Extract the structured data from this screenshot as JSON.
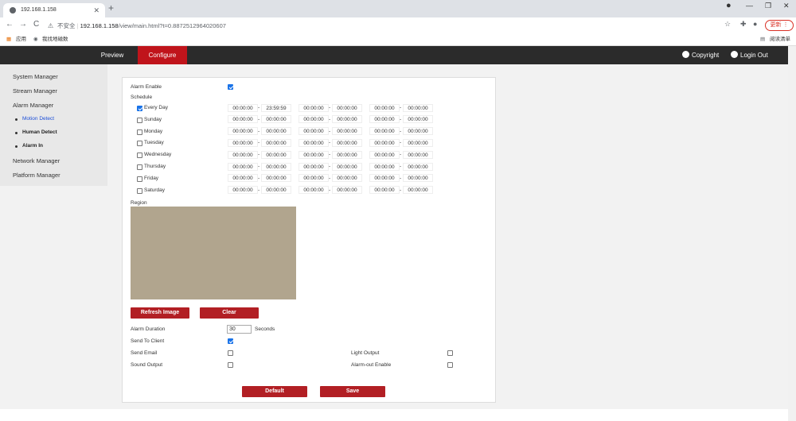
{
  "browser": {
    "tab_title": "192.168.1.158",
    "new_tab": "+",
    "back": "←",
    "forward": "→",
    "reload": "C",
    "security": "不安全",
    "url_host": "192.168.1.158",
    "url_path": "/view/main.html?t=0.8872512964020607",
    "update_label": "更新",
    "bookmarks": [
      "应用",
      "我找地磁数"
    ],
    "reading_list": "阅读清单"
  },
  "topbar": {
    "menus": [
      "Preview",
      "Configure"
    ],
    "active": "Configure",
    "copyright": "Copyright",
    "logout": "Login Out"
  },
  "sidebar": {
    "items": [
      "System Manager",
      "Stream Manager",
      "Alarm Manager",
      "Network Manager",
      "Platform Manager"
    ],
    "subitems": [
      "Motion Detect",
      "Human Detect",
      "Alarm In"
    ],
    "active_sub": "Motion Detect"
  },
  "form": {
    "alarm_enable": "Alarm Enable",
    "alarm_enable_checked": true,
    "schedule": "Schedule",
    "days": [
      {
        "label": "Every Day",
        "checked": true,
        "times": [
          "00:00:00",
          "23:59:59",
          "00:00:00",
          "00:00:00",
          "00:00:00",
          "00:00:00"
        ]
      },
      {
        "label": "Sunday",
        "checked": false,
        "times": [
          "00:00:00",
          "00:00:00",
          "00:00:00",
          "00:00:00",
          "00:00:00",
          "00:00:00"
        ]
      },
      {
        "label": "Monday",
        "checked": false,
        "times": [
          "00:00:00",
          "00:00:00",
          "00:00:00",
          "00:00:00",
          "00:00:00",
          "00:00:00"
        ]
      },
      {
        "label": "Tuesday",
        "checked": false,
        "times": [
          "00:00:00",
          "00:00:00",
          "00:00:00",
          "00:00:00",
          "00:00:00",
          "00:00:00"
        ]
      },
      {
        "label": "Wednesday",
        "checked": false,
        "times": [
          "00:00:00",
          "00:00:00",
          "00:00:00",
          "00:00:00",
          "00:00:00",
          "00:00:00"
        ]
      },
      {
        "label": "Thursday",
        "checked": false,
        "times": [
          "00:00:00",
          "00:00:00",
          "00:00:00",
          "00:00:00",
          "00:00:00",
          "00:00:00"
        ]
      },
      {
        "label": "Friday",
        "checked": false,
        "times": [
          "00:00:00",
          "00:00:00",
          "00:00:00",
          "00:00:00",
          "00:00:00",
          "00:00:00"
        ]
      },
      {
        "label": "Saturday",
        "checked": false,
        "times": [
          "00:00:00",
          "00:00:00",
          "00:00:00",
          "00:00:00",
          "00:00:00",
          "00:00:00"
        ]
      }
    ],
    "region": "Region",
    "refresh_image": "Refresh Image",
    "clear": "Clear",
    "alarm_duration": "Alarm Duration",
    "alarm_duration_value": "30",
    "seconds": "Seconds",
    "send_to_client": "Send To Client",
    "send_to_client_checked": true,
    "send_email": "Send Email",
    "sound_output": "Sound Output",
    "light_output": "Light Output",
    "alarm_out_enable": "Alarm-out Enable",
    "default": "Default",
    "save": "Save"
  }
}
